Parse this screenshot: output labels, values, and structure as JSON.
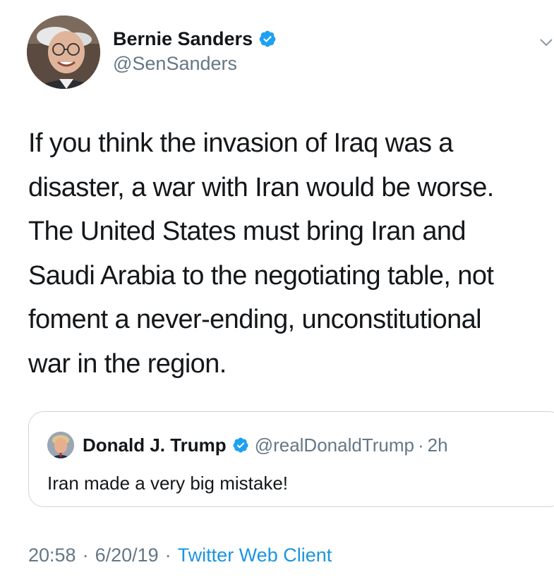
{
  "author": {
    "display_name": "Bernie Sanders",
    "handle": "@SenSanders",
    "verified": true
  },
  "tweet": {
    "text": "If you think the invasion of Iraq was a\ndisaster, a war with Iran would be worse.\nThe United States must bring Iran and\nSaudi Arabia to the negotiating table, not\nfoment a never-ending, unconstitutional\nwar in the region."
  },
  "quoted_tweet": {
    "display_name": "Donald J. Trump",
    "handle": "@realDonaldTrump",
    "separator": "·",
    "age": "2h",
    "verified": true,
    "text": "Iran made a very big mistake!"
  },
  "meta": {
    "time": "20:58",
    "separator": "·",
    "date": "6/20/19",
    "source": "Twitter Web Client"
  },
  "colors": {
    "verified_badge": "#1da1f2",
    "secondary_text": "#657786",
    "link": "#1b95e0",
    "border": "#ccd6dd"
  },
  "icons": {
    "caret": "chevron-down-icon",
    "verified": "verified-badge-icon"
  }
}
